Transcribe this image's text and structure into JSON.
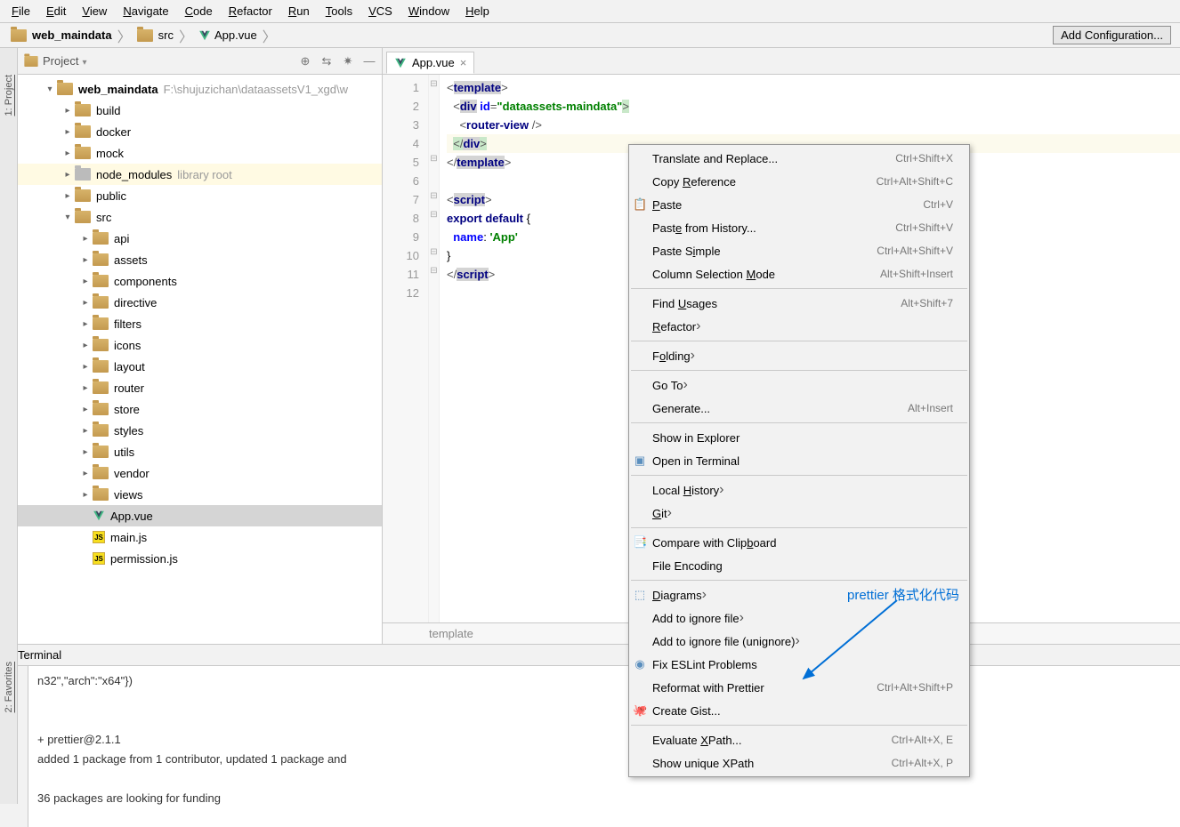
{
  "menubar": [
    "File",
    "Edit",
    "View",
    "Navigate",
    "Code",
    "Refactor",
    "Run",
    "Tools",
    "VCS",
    "Window",
    "Help"
  ],
  "menubar_ul": [
    "F",
    "E",
    "V",
    "N",
    "C",
    "R",
    "R",
    "T",
    "V",
    "W",
    "H"
  ],
  "navbar": {
    "crumbs": [
      "web_maindata",
      "src",
      "App.vue"
    ],
    "add_config": "Add Configuration..."
  },
  "project": {
    "title": "Project",
    "root_name": "web_maindata",
    "root_path": "F:\\shujuzichan\\dataassetsV1_xgd\\w",
    "items": [
      {
        "depth": 1,
        "tw": "▾",
        "icon": "folder",
        "label": "web_maindata",
        "bold": true,
        "note": "F:\\shujuzichan\\dataassetsV1_xgd\\w"
      },
      {
        "depth": 2,
        "tw": "▸",
        "icon": "folder",
        "label": "build"
      },
      {
        "depth": 2,
        "tw": "▸",
        "icon": "folder",
        "label": "docker"
      },
      {
        "depth": 2,
        "tw": "▸",
        "icon": "folder",
        "label": "mock"
      },
      {
        "depth": 2,
        "tw": "▸",
        "icon": "folder-gray",
        "label": "node_modules",
        "note": "library root",
        "hl": true
      },
      {
        "depth": 2,
        "tw": "▸",
        "icon": "folder",
        "label": "public"
      },
      {
        "depth": 2,
        "tw": "▾",
        "icon": "folder",
        "label": "src"
      },
      {
        "depth": 3,
        "tw": "▸",
        "icon": "folder",
        "label": "api"
      },
      {
        "depth": 3,
        "tw": "▸",
        "icon": "folder",
        "label": "assets"
      },
      {
        "depth": 3,
        "tw": "▸",
        "icon": "folder",
        "label": "components"
      },
      {
        "depth": 3,
        "tw": "▸",
        "icon": "folder",
        "label": "directive"
      },
      {
        "depth": 3,
        "tw": "▸",
        "icon": "folder",
        "label": "filters"
      },
      {
        "depth": 3,
        "tw": "▸",
        "icon": "folder",
        "label": "icons"
      },
      {
        "depth": 3,
        "tw": "▸",
        "icon": "folder",
        "label": "layout"
      },
      {
        "depth": 3,
        "tw": "▸",
        "icon": "folder",
        "label": "router"
      },
      {
        "depth": 3,
        "tw": "▸",
        "icon": "folder",
        "label": "store"
      },
      {
        "depth": 3,
        "tw": "▸",
        "icon": "folder",
        "label": "styles"
      },
      {
        "depth": 3,
        "tw": "▸",
        "icon": "folder",
        "label": "utils"
      },
      {
        "depth": 3,
        "tw": "▸",
        "icon": "folder",
        "label": "vendor"
      },
      {
        "depth": 3,
        "tw": "▸",
        "icon": "folder",
        "label": "views"
      },
      {
        "depth": 3,
        "tw": "",
        "icon": "vue",
        "label": "App.vue",
        "selected": true
      },
      {
        "depth": 3,
        "tw": "",
        "icon": "js",
        "label": "main.js"
      },
      {
        "depth": 3,
        "tw": "",
        "icon": "js",
        "label": "permission.js"
      }
    ]
  },
  "editor": {
    "tab": "App.vue",
    "breadcrumb": "template",
    "lines": [
      "1",
      "2",
      "3",
      "4",
      "5",
      "6",
      "7",
      "8",
      "9",
      "10",
      "11",
      "12"
    ]
  },
  "ctx": [
    {
      "t": "item",
      "label": "Translate and Replace...",
      "sc": "Ctrl+Shift+X"
    },
    {
      "t": "item",
      "label": "Copy Reference",
      "ul": "R",
      "sc": "Ctrl+Alt+Shift+C"
    },
    {
      "t": "item",
      "label": "Paste",
      "ul": "P",
      "sc": "Ctrl+V",
      "ico": "📋"
    },
    {
      "t": "item",
      "label": "Paste from History...",
      "ul": "e",
      "sc": "Ctrl+Shift+V"
    },
    {
      "t": "item",
      "label": "Paste Simple",
      "ul": "i",
      "sc": "Ctrl+Alt+Shift+V"
    },
    {
      "t": "item",
      "label": "Column Selection Mode",
      "ul": "M",
      "sc": "Alt+Shift+Insert"
    },
    {
      "t": "sep"
    },
    {
      "t": "item",
      "label": "Find Usages",
      "ul": "U",
      "sc": "Alt+Shift+7"
    },
    {
      "t": "item",
      "label": "Refactor",
      "ul": "R",
      "sub": true
    },
    {
      "t": "sep"
    },
    {
      "t": "item",
      "label": "Folding",
      "ul": "o",
      "sub": true
    },
    {
      "t": "sep"
    },
    {
      "t": "item",
      "label": "Go To",
      "sub": true
    },
    {
      "t": "item",
      "label": "Generate...",
      "sc": "Alt+Insert"
    },
    {
      "t": "sep"
    },
    {
      "t": "item",
      "label": "Show in Explorer"
    },
    {
      "t": "item",
      "label": "Open in Terminal",
      "ico": "▣"
    },
    {
      "t": "sep"
    },
    {
      "t": "item",
      "label": "Local History",
      "ul": "H",
      "sub": true
    },
    {
      "t": "item",
      "label": "Git",
      "ul": "G",
      "sub": true
    },
    {
      "t": "sep"
    },
    {
      "t": "item",
      "label": "Compare with Clipboard",
      "ul": "b",
      "ico": "📑"
    },
    {
      "t": "item",
      "label": "File Encoding"
    },
    {
      "t": "sep"
    },
    {
      "t": "item",
      "label": "Diagrams",
      "ul": "D",
      "sub": true,
      "ico": "⬚"
    },
    {
      "t": "item",
      "label": "Add to ignore file",
      "sub": true
    },
    {
      "t": "item",
      "label": "Add to ignore file (unignore)",
      "sub": true
    },
    {
      "t": "item",
      "label": "Fix ESLint Problems",
      "ico": "◉"
    },
    {
      "t": "item",
      "label": "Reformat with Prettier",
      "sc": "Ctrl+Alt+Shift+P"
    },
    {
      "t": "item",
      "label": "Create Gist...",
      "ico": "🐙"
    },
    {
      "t": "sep"
    },
    {
      "t": "item",
      "label": "Evaluate XPath...",
      "ul": "X",
      "sc": "Ctrl+Alt+X, E"
    },
    {
      "t": "item",
      "label": "Show unique XPath",
      "sc": "Ctrl+Alt+X, P"
    }
  ],
  "annotation": "prettier 格式化代码",
  "terminal": {
    "title": "Terminal",
    "lines": [
      "n32\",\"arch\":\"x64\"})",
      "",
      "",
      "+ prettier@2.1.1",
      "added 1 package from 1 contributor, updated 1 package and",
      "",
      "36 packages are looking for funding"
    ]
  },
  "side_left": [
    "1: Project"
  ],
  "side_left2": [
    "2: Favorites"
  ]
}
